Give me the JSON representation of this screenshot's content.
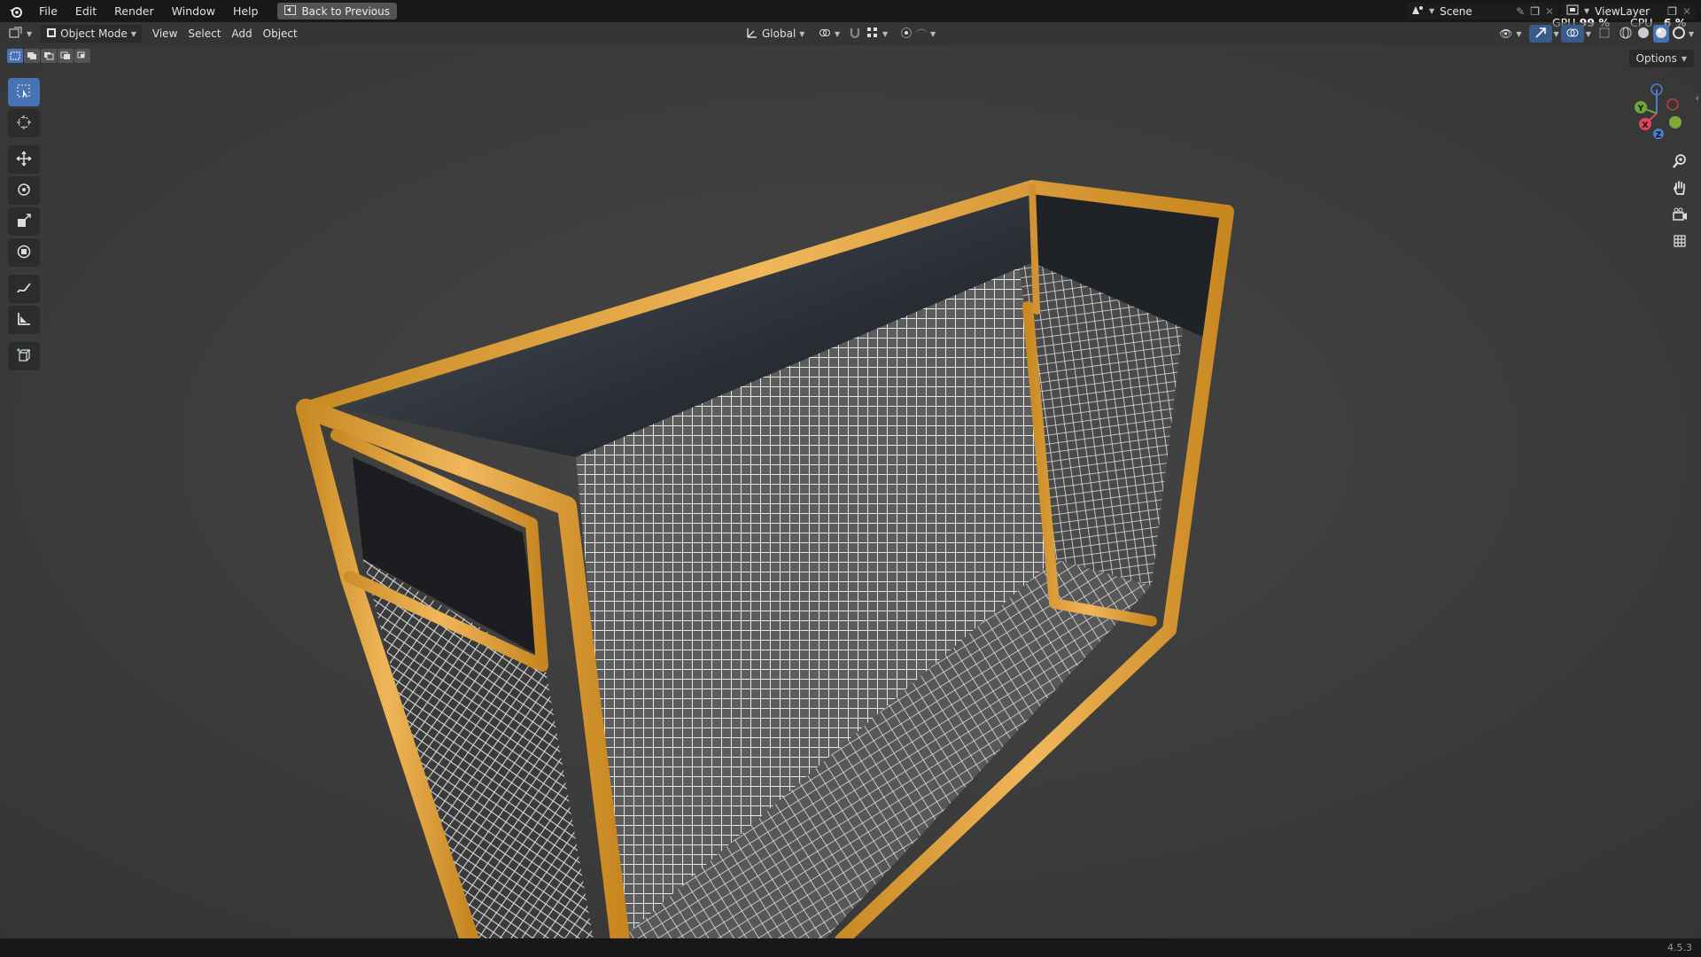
{
  "menu": {
    "items": [
      "File",
      "Edit",
      "Render",
      "Window",
      "Help"
    ],
    "back_button": "Back to Previous"
  },
  "top_right": {
    "scene_name": "Scene",
    "view_layer": "ViewLayer",
    "gpu_label": "GPU",
    "gpu_value": "99 %",
    "cpu_label": "CPU",
    "cpu_value": "6 %"
  },
  "viewport_header": {
    "mode": "Object Mode",
    "menus": [
      "View",
      "Select",
      "Add",
      "Object"
    ],
    "orientation": "Global"
  },
  "options_label": "Options",
  "gizmo": {
    "y_label": "Y",
    "x_label": "X",
    "z_label": "Z"
  },
  "status": {
    "version": "4.5.3"
  },
  "colors": {
    "frame_orange": "#e0a040",
    "active_tool": "#4772b3",
    "background": "#3d3d3d"
  },
  "icons": {
    "toolbar": [
      "select-box-icon",
      "cursor-icon",
      "move-icon",
      "rotate-icon",
      "scale-icon",
      "transform-icon",
      "annotate-icon",
      "measure-icon",
      "add-cube-icon"
    ],
    "navigation": [
      "zoom-icon",
      "pan-hand-icon",
      "camera-icon",
      "grid-view-icon"
    ]
  }
}
